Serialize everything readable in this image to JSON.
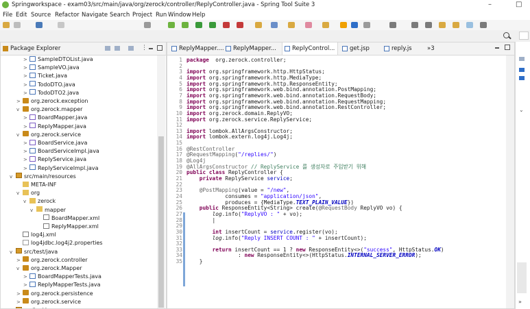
{
  "window": {
    "title": "Springworkspace - exam03/src/main/java/org/zerock/controller/ReplyController.java - Spring Tool Suite 3",
    "minimize": "–",
    "maximize": "□"
  },
  "menu": [
    "File",
    "Edit",
    "Source",
    "Refactor",
    "Navigate",
    "Search",
    "Project",
    "Run",
    "Window",
    "Help"
  ],
  "package_explorer": {
    "title": "Package Explorer",
    "tree": [
      {
        "label": "SampleDTOList.java",
        "icon": "java",
        "indent": 3,
        "twisty": ">"
      },
      {
        "label": "SampleVO.java",
        "icon": "java",
        "indent": 3,
        "twisty": ">"
      },
      {
        "label": "Ticket.java",
        "icon": "java",
        "indent": 3,
        "twisty": ">"
      },
      {
        "label": "TodoDTO.java",
        "icon": "java",
        "indent": 3,
        "twisty": ">"
      },
      {
        "label": "TodoDTO2.java",
        "icon": "java",
        "indent": 3,
        "twisty": ">"
      },
      {
        "label": "org.zerock.exception",
        "icon": "pkg",
        "indent": 2,
        "twisty": ">"
      },
      {
        "label": "org.zerock.mapper",
        "icon": "pkg",
        "indent": 2,
        "twisty": "v"
      },
      {
        "label": "BoardMapper.java",
        "icon": "ijava",
        "indent": 3,
        "twisty": ">"
      },
      {
        "label": "ReplyMapper.java",
        "icon": "ijava",
        "indent": 3,
        "twisty": ">"
      },
      {
        "label": "org.zerock.service",
        "icon": "pkg",
        "indent": 2,
        "twisty": "v"
      },
      {
        "label": "BoardService.java",
        "icon": "ijava",
        "indent": 3,
        "twisty": ">"
      },
      {
        "label": "BoardServiceImpl.java",
        "icon": "java",
        "indent": 3,
        "twisty": ">"
      },
      {
        "label": "ReplyService.java",
        "icon": "ijava",
        "indent": 3,
        "twisty": ">"
      },
      {
        "label": "ReplyServiceImpl.java",
        "icon": "java",
        "indent": 3,
        "twisty": ">"
      },
      {
        "label": "src/main/resources",
        "icon": "src",
        "indent": 1,
        "twisty": "v"
      },
      {
        "label": "META-INF",
        "icon": "folder",
        "indent": 2,
        "twisty": ""
      },
      {
        "label": "org",
        "icon": "folder",
        "indent": 2,
        "twisty": "v"
      },
      {
        "label": "zerock",
        "icon": "folder",
        "indent": 3,
        "twisty": "v"
      },
      {
        "label": "mapper",
        "icon": "folder",
        "indent": 4,
        "twisty": "v"
      },
      {
        "label": "BoardMapper.xml",
        "icon": "xml",
        "indent": 5,
        "twisty": ""
      },
      {
        "label": "ReplyMapper.xml",
        "icon": "xml",
        "indent": 5,
        "twisty": ""
      },
      {
        "label": "log4j.xml",
        "icon": "xml",
        "indent": 2,
        "twisty": ""
      },
      {
        "label": "log4jdbc.log4j2.properties",
        "icon": "props",
        "indent": 2,
        "twisty": ""
      },
      {
        "label": "src/test/java",
        "icon": "src",
        "indent": 1,
        "twisty": "v"
      },
      {
        "label": "org.zerock.controller",
        "icon": "pkg",
        "indent": 2,
        "twisty": ">"
      },
      {
        "label": "org.zerock.Mapper",
        "icon": "pkg",
        "indent": 2,
        "twisty": "v"
      },
      {
        "label": "BoardMapperTests.java",
        "icon": "java",
        "indent": 3,
        "twisty": ">"
      },
      {
        "label": "ReplyMapperTests.java",
        "icon": "java",
        "indent": 3,
        "twisty": ">"
      },
      {
        "label": "org.zerock.persistence",
        "icon": "pkg",
        "indent": 2,
        "twisty": ">"
      },
      {
        "label": "org.zerock.service",
        "icon": "pkg",
        "indent": 2,
        "twisty": ">"
      },
      {
        "label": "src/test/resources",
        "icon": "src",
        "indent": 1,
        "twisty": ">"
      }
    ]
  },
  "editor": {
    "tabs": [
      {
        "label": "ReplyMapper....",
        "active": false
      },
      {
        "label": "ReplyMapper...",
        "active": false
      },
      {
        "label": "ReplyControl...",
        "active": true
      },
      {
        "label": "get.jsp",
        "active": false
      },
      {
        "label": "reply.js",
        "active": false
      },
      {
        "label": "»3",
        "active": false
      }
    ]
  }
}
